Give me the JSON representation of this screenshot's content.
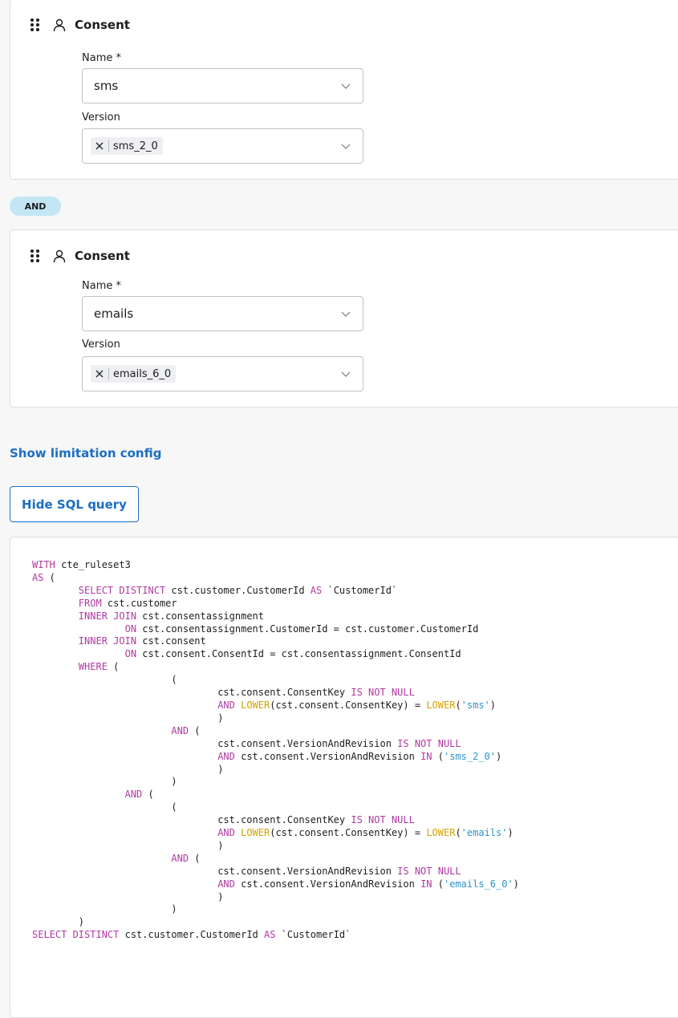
{
  "conditions": [
    {
      "title": "Consent",
      "name_label": "Name *",
      "name_value": "sms",
      "version_label": "Version",
      "version_chip": "sms_2_0"
    },
    {
      "title": "Consent",
      "name_label": "Name *",
      "name_value": "emails",
      "version_label": "Version",
      "version_chip": "emails_6_0"
    }
  ],
  "operator_badge": "AND",
  "show_limitation_link": "Show limitation config",
  "hide_sql_button": "Hide SQL query",
  "colors": {
    "accent": "#1b6ec2",
    "badge_bg": "#c3e6f4",
    "sql_keyword": "#b03aa0",
    "sql_function": "#d4a200",
    "sql_string": "#2e93c7"
  },
  "sql": {
    "l1a": "WITH",
    "l1b": " cte_ruleset3",
    "l2": "AS",
    "l2b": " (",
    "l3a": "        ",
    "l3b": "SELECT DISTINCT",
    "l3c": " cst.customer.CustomerId ",
    "l3d": "AS",
    "l3e": " `CustomerId`",
    "l4a": "        ",
    "l4b": "FROM",
    "l4c": " cst.customer",
    "l5a": "        ",
    "l5b": "INNER JOIN",
    "l5c": " cst.consentassignment",
    "l6a": "                ",
    "l6b": "ON",
    "l6c": " cst.consentassignment.CustomerId = cst.customer.CustomerId",
    "l7a": "        ",
    "l7b": "INNER JOIN",
    "l7c": " cst.consent",
    "l8a": "                ",
    "l8b": "ON",
    "l8c": " cst.consent.ConsentId = cst.consentassignment.ConsentId",
    "l9a": "        ",
    "l9b": "WHERE",
    "l9c": " (",
    "l10": "                        (",
    "l11a": "                                cst.consent.ConsentKey ",
    "l11b": "IS NOT NULL",
    "l12a": "                                ",
    "l12b": "AND",
    "l12c": " ",
    "l12d": "LOWER",
    "l12e": "(cst.consent.ConsentKey) = ",
    "l12f": "LOWER",
    "l12g": "(",
    "l12h": "'sms'",
    "l12i": ")",
    "l13": "                                )",
    "l14a": "                        ",
    "l14b": "AND",
    "l14c": " (",
    "l15a": "                                cst.consent.VersionAndRevision ",
    "l15b": "IS NOT NULL",
    "l16a": "                                ",
    "l16b": "AND",
    "l16c": " cst.consent.VersionAndRevision ",
    "l16d": "IN",
    "l16e": " (",
    "l16f": "'sms_2_0'",
    "l16g": ")",
    "l17": "                                )",
    "l18": "                        )",
    "l19a": "                ",
    "l19b": "AND",
    "l19c": " (",
    "l20": "                        (",
    "l21a": "                                cst.consent.ConsentKey ",
    "l21b": "IS NOT NULL",
    "l22a": "                                ",
    "l22b": "AND",
    "l22c": " ",
    "l22d": "LOWER",
    "l22e": "(cst.consent.ConsentKey) = ",
    "l22f": "LOWER",
    "l22g": "(",
    "l22h": "'emails'",
    "l22i": ")",
    "l23": "                                )",
    "l24a": "                        ",
    "l24b": "AND",
    "l24c": " (",
    "l25a": "                                cst.consent.VersionAndRevision ",
    "l25b": "IS NOT NULL",
    "l26a": "                                ",
    "l26b": "AND",
    "l26c": " cst.consent.VersionAndRevision ",
    "l26d": "IN",
    "l26e": " (",
    "l26f": "'emails_6_0'",
    "l26g": ")",
    "l27": "                                )",
    "l28": "                        )",
    "l29": "        )",
    "l30a": "SELECT DISTINCT",
    "l30b": " cst.customer.CustomerId ",
    "l30c": "AS",
    "l30d": " `CustomerId`"
  }
}
